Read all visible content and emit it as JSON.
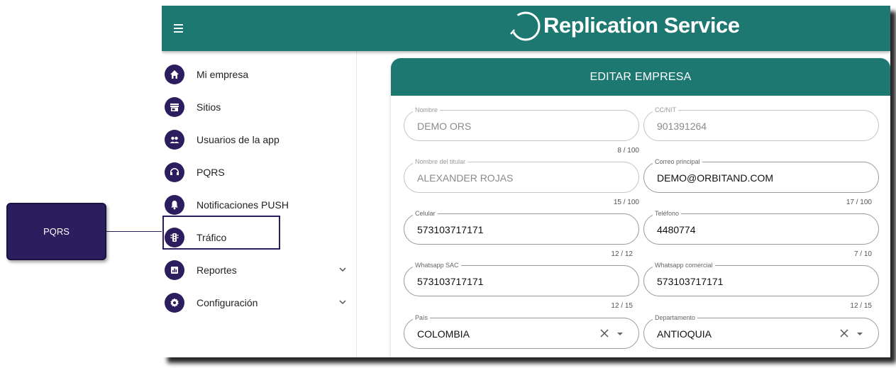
{
  "callout": {
    "label": "PQRS"
  },
  "header": {
    "brand": "Replication Service"
  },
  "sidebar": {
    "items": [
      {
        "label": "Mi empresa",
        "icon": "home-icon"
      },
      {
        "label": "Sitios",
        "icon": "store-icon"
      },
      {
        "label": "Usuarios de la app",
        "icon": "people-icon"
      },
      {
        "label": "PQRS",
        "icon": "headset-icon"
      },
      {
        "label": "Notificaciones PUSH",
        "icon": "bell-icon"
      },
      {
        "label": "Tráfico",
        "icon": "traffic-light-icon"
      },
      {
        "label": "Reportes",
        "icon": "bar-chart-icon",
        "expandable": true
      },
      {
        "label": "Configuración",
        "icon": "gear-icon",
        "expandable": true
      }
    ],
    "highlighted": "Tráfico"
  },
  "form": {
    "title": "EDITAR EMPRESA",
    "fields": {
      "nombre": {
        "label": "Nombre",
        "value": "DEMO ORS",
        "counter": "8 / 100",
        "disabled": true
      },
      "nit": {
        "label": "CC/NIT",
        "value": "901391264",
        "disabled": true
      },
      "titular": {
        "label": "Nombre del titular",
        "value": "ALEXANDER ROJAS",
        "counter": "15 / 100",
        "disabled": true
      },
      "correo": {
        "label": "Correo principal",
        "value": "DEMO@ORBITAND.COM",
        "counter": "17 / 100"
      },
      "celular": {
        "label": "Celular",
        "value": "573103717171",
        "counter": "12 / 12"
      },
      "telefono": {
        "label": "Teléfono",
        "value": "4480774",
        "counter": "7 / 10"
      },
      "whatsapp_sac": {
        "label": "Whatsapp SAC",
        "value": "573103717171",
        "counter": "12 / 15"
      },
      "whatsapp_comercial": {
        "label": "Whatsapp comercial",
        "value": "573103717171",
        "counter": "12 / 15"
      },
      "pais": {
        "label": "País",
        "value": "COLOMBIA"
      },
      "departamento": {
        "label": "Departamento",
        "value": "ANTIOQUIA"
      }
    }
  },
  "colors": {
    "primary": "#1d7872",
    "accent": "#2b1d5e"
  }
}
